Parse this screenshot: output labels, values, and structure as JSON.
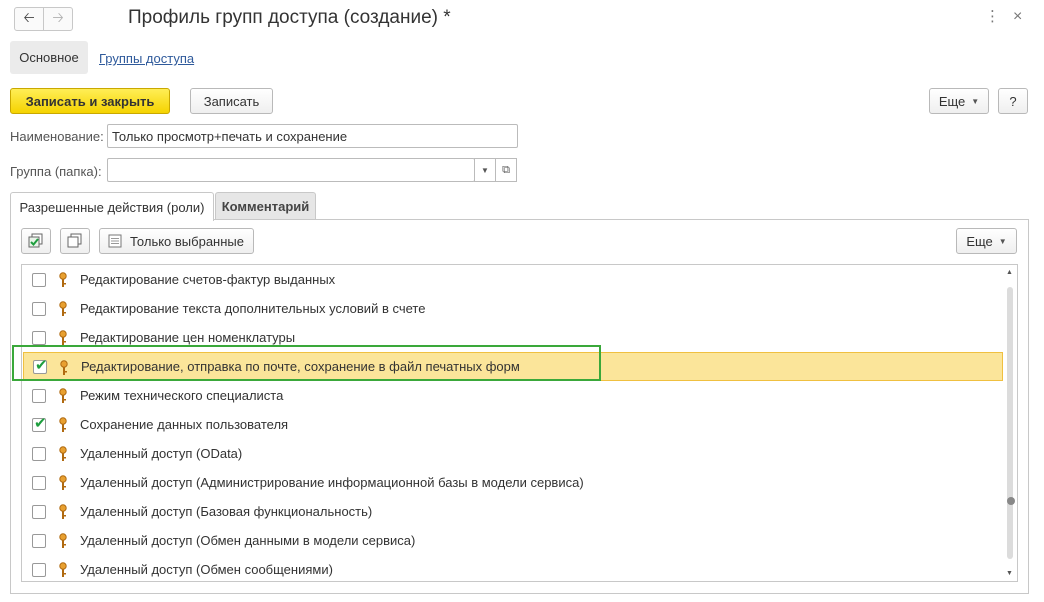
{
  "window": {
    "title": "Профиль групп доступа (создание) *",
    "back_icon": "arrow-left-icon",
    "forward_icon": "arrow-right-icon",
    "more_icon": "⋮",
    "close_icon": "×"
  },
  "sections": {
    "main": "Основное",
    "access_groups": "Группы доступа"
  },
  "toolbar": {
    "save_close": "Записать и закрыть",
    "save": "Записать",
    "more": "Еще",
    "help": "?"
  },
  "form": {
    "name_label": "Наименование:",
    "name_value": "Только просмотр+печать и сохранение",
    "group_label": "Группа (папка):",
    "group_value": ""
  },
  "tabs": {
    "roles": "Разрешенные действия (роли)",
    "comment": "Комментарий"
  },
  "list_toolbar": {
    "only_selected": "Только выбранные",
    "more": "Еще"
  },
  "roles": [
    {
      "label": "Редактирование счетов-фактур выданных",
      "checked": false
    },
    {
      "label": "Редактирование текста дополнительных условий в счете",
      "checked": false
    },
    {
      "label": "Редактирование цен номенклатуры",
      "checked": false
    },
    {
      "label": "Редактирование, отправка по почте, сохранение в файл печатных форм",
      "checked": true,
      "selected": true
    },
    {
      "label": "Режим технического специалиста",
      "checked": false
    },
    {
      "label": "Сохранение данных пользователя",
      "checked": true
    },
    {
      "label": "Удаленный доступ (OData)",
      "checked": false
    },
    {
      "label": "Удаленный доступ (Администрирование информационной базы в модели сервиса)",
      "checked": false
    },
    {
      "label": "Удаленный доступ (Базовая функциональность)",
      "checked": false
    },
    {
      "label": "Удаленный доступ (Обмен данными в модели сервиса)",
      "checked": false
    },
    {
      "label": "Удаленный доступ (Обмен сообщениями)",
      "checked": false
    }
  ],
  "colors": {
    "primary_button": "#f5d300",
    "selected_row": "#fbe59a",
    "highlight_frame": "#3aa83a",
    "check_mark": "#1e9e3e",
    "link": "#2f5a9b"
  }
}
